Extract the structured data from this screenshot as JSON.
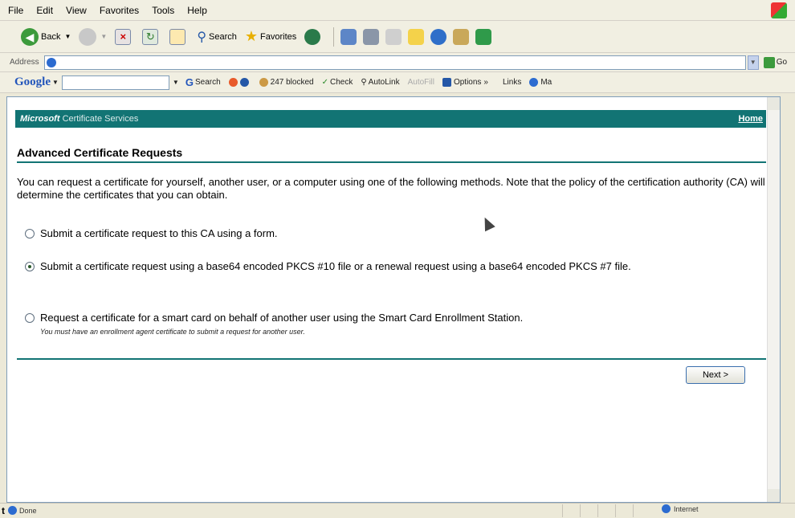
{
  "menu": [
    "File",
    "Edit",
    "View",
    "Favorites",
    "Tools",
    "Help"
  ],
  "toolbar": {
    "back": "Back",
    "search": "Search",
    "favorites": "Favorites"
  },
  "address": {
    "label": "Address",
    "go": "Go"
  },
  "google": {
    "logo": "Google",
    "search": "Search",
    "blocked": "247 blocked",
    "check": "Check",
    "autolink": "AutoLink",
    "autofill": "AutoFill",
    "options": "Options",
    "links": "Links",
    "more": "Ma"
  },
  "page": {
    "banner_brand": "Microsoft",
    "banner_service": "Certificate Services",
    "home_link": "Home",
    "heading": "Advanced Certificate Requests",
    "intro": "You can request a certificate for yourself, another user, or a computer using one of the following methods. Note that the policy of the certification authority (CA) will determine the certificates that you can obtain.",
    "options": [
      {
        "label": "Submit a certificate request to this CA using a form.",
        "selected": false
      },
      {
        "label": "Submit a certificate request using a base64 encoded PKCS #10 file or a renewal request using a base64 encoded PKCS #7 file.",
        "selected": true
      },
      {
        "label": "Request a certificate for a smart card on behalf of another user using the Smart Card Enrollment Station.",
        "note": "You must have an enrollment agent certificate to submit a request for another user.",
        "selected": false
      }
    ],
    "next_button": "Next >"
  },
  "status": {
    "prefix": "t",
    "text": "Done",
    "zone": "Internet"
  },
  "colors": {
    "banner": "#127474",
    "chrome": "#ece9d8"
  },
  "icons": [
    "back-icon",
    "forward-icon",
    "stop-icon",
    "refresh-icon",
    "home-icon",
    "search-icon",
    "favorites-star-icon",
    "history-icon",
    "mail-icon",
    "print-icon",
    "edit-icon",
    "discuss-icon",
    "messenger-icon",
    "research-icon",
    "windows-flag-icon"
  ]
}
